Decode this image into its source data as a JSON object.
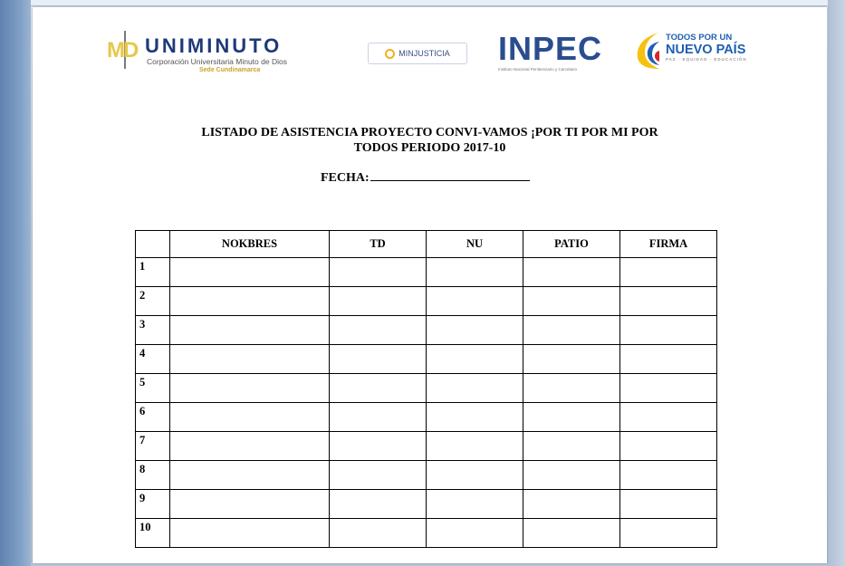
{
  "logos": {
    "md_mark": "MD",
    "uniminuto_name": "UNIMINUTO",
    "uniminuto_subtitle": "Corporación Universitaria Minuto de Dios",
    "uniminuto_sede": "Sede Cundinamarca",
    "minjusticia": "MINJUSTICIA",
    "inpec": "INPEC",
    "inpec_subtitle": "Instituto Nacional Penitenciario y Carcelario",
    "todos_line1": "TODOS POR UN",
    "todos_line2": "NUEVO PAÍS",
    "todos_line3": "PAZ · EQUIDAD · EDUCACIÓN",
    "flag_colors": [
      "#f5c20f",
      "#1f5fb0",
      "#d9252a"
    ]
  },
  "document": {
    "title_line1": "LISTADO DE ASISTENCIA PROYECTO CONVI-VAMOS ¡POR TI POR MI POR",
    "title_line2": "TODOS PERIODO 2017-10",
    "fecha_label": "FECHA:"
  },
  "table": {
    "headers": [
      "",
      "NOKBRES",
      "TD",
      "NU",
      "PATIO",
      "FIRMA"
    ],
    "rows": [
      {
        "num": "1"
      },
      {
        "num": "2"
      },
      {
        "num": "3"
      },
      {
        "num": "4"
      },
      {
        "num": "5"
      },
      {
        "num": "6"
      },
      {
        "num": "7"
      },
      {
        "num": "8"
      },
      {
        "num": "9"
      },
      {
        "num": "10"
      }
    ]
  }
}
